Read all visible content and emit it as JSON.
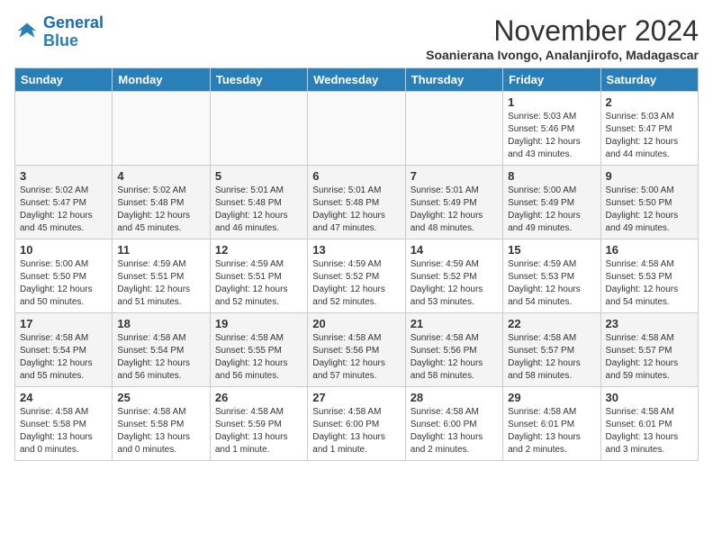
{
  "logo": {
    "line1": "General",
    "line2": "Blue"
  },
  "title": "November 2024",
  "subtitle": "Soanierana Ivongo, Analanjirofo, Madagascar",
  "headers": [
    "Sunday",
    "Monday",
    "Tuesday",
    "Wednesday",
    "Thursday",
    "Friday",
    "Saturday"
  ],
  "weeks": [
    [
      {
        "day": "",
        "info": ""
      },
      {
        "day": "",
        "info": ""
      },
      {
        "day": "",
        "info": ""
      },
      {
        "day": "",
        "info": ""
      },
      {
        "day": "",
        "info": ""
      },
      {
        "day": "1",
        "info": "Sunrise: 5:03 AM\nSunset: 5:46 PM\nDaylight: 12 hours\nand 43 minutes."
      },
      {
        "day": "2",
        "info": "Sunrise: 5:03 AM\nSunset: 5:47 PM\nDaylight: 12 hours\nand 44 minutes."
      }
    ],
    [
      {
        "day": "3",
        "info": "Sunrise: 5:02 AM\nSunset: 5:47 PM\nDaylight: 12 hours\nand 45 minutes."
      },
      {
        "day": "4",
        "info": "Sunrise: 5:02 AM\nSunset: 5:48 PM\nDaylight: 12 hours\nand 45 minutes."
      },
      {
        "day": "5",
        "info": "Sunrise: 5:01 AM\nSunset: 5:48 PM\nDaylight: 12 hours\nand 46 minutes."
      },
      {
        "day": "6",
        "info": "Sunrise: 5:01 AM\nSunset: 5:48 PM\nDaylight: 12 hours\nand 47 minutes."
      },
      {
        "day": "7",
        "info": "Sunrise: 5:01 AM\nSunset: 5:49 PM\nDaylight: 12 hours\nand 48 minutes."
      },
      {
        "day": "8",
        "info": "Sunrise: 5:00 AM\nSunset: 5:49 PM\nDaylight: 12 hours\nand 49 minutes."
      },
      {
        "day": "9",
        "info": "Sunrise: 5:00 AM\nSunset: 5:50 PM\nDaylight: 12 hours\nand 49 minutes."
      }
    ],
    [
      {
        "day": "10",
        "info": "Sunrise: 5:00 AM\nSunset: 5:50 PM\nDaylight: 12 hours\nand 50 minutes."
      },
      {
        "day": "11",
        "info": "Sunrise: 4:59 AM\nSunset: 5:51 PM\nDaylight: 12 hours\nand 51 minutes."
      },
      {
        "day": "12",
        "info": "Sunrise: 4:59 AM\nSunset: 5:51 PM\nDaylight: 12 hours\nand 52 minutes."
      },
      {
        "day": "13",
        "info": "Sunrise: 4:59 AM\nSunset: 5:52 PM\nDaylight: 12 hours\nand 52 minutes."
      },
      {
        "day": "14",
        "info": "Sunrise: 4:59 AM\nSunset: 5:52 PM\nDaylight: 12 hours\nand 53 minutes."
      },
      {
        "day": "15",
        "info": "Sunrise: 4:59 AM\nSunset: 5:53 PM\nDaylight: 12 hours\nand 54 minutes."
      },
      {
        "day": "16",
        "info": "Sunrise: 4:58 AM\nSunset: 5:53 PM\nDaylight: 12 hours\nand 54 minutes."
      }
    ],
    [
      {
        "day": "17",
        "info": "Sunrise: 4:58 AM\nSunset: 5:54 PM\nDaylight: 12 hours\nand 55 minutes."
      },
      {
        "day": "18",
        "info": "Sunrise: 4:58 AM\nSunset: 5:54 PM\nDaylight: 12 hours\nand 56 minutes."
      },
      {
        "day": "19",
        "info": "Sunrise: 4:58 AM\nSunset: 5:55 PM\nDaylight: 12 hours\nand 56 minutes."
      },
      {
        "day": "20",
        "info": "Sunrise: 4:58 AM\nSunset: 5:56 PM\nDaylight: 12 hours\nand 57 minutes."
      },
      {
        "day": "21",
        "info": "Sunrise: 4:58 AM\nSunset: 5:56 PM\nDaylight: 12 hours\nand 58 minutes."
      },
      {
        "day": "22",
        "info": "Sunrise: 4:58 AM\nSunset: 5:57 PM\nDaylight: 12 hours\nand 58 minutes."
      },
      {
        "day": "23",
        "info": "Sunrise: 4:58 AM\nSunset: 5:57 PM\nDaylight: 12 hours\nand 59 minutes."
      }
    ],
    [
      {
        "day": "24",
        "info": "Sunrise: 4:58 AM\nSunset: 5:58 PM\nDaylight: 13 hours\nand 0 minutes."
      },
      {
        "day": "25",
        "info": "Sunrise: 4:58 AM\nSunset: 5:58 PM\nDaylight: 13 hours\nand 0 minutes."
      },
      {
        "day": "26",
        "info": "Sunrise: 4:58 AM\nSunset: 5:59 PM\nDaylight: 13 hours\nand 1 minute."
      },
      {
        "day": "27",
        "info": "Sunrise: 4:58 AM\nSunset: 6:00 PM\nDaylight: 13 hours\nand 1 minute."
      },
      {
        "day": "28",
        "info": "Sunrise: 4:58 AM\nSunset: 6:00 PM\nDaylight: 13 hours\nand 2 minutes."
      },
      {
        "day": "29",
        "info": "Sunrise: 4:58 AM\nSunset: 6:01 PM\nDaylight: 13 hours\nand 2 minutes."
      },
      {
        "day": "30",
        "info": "Sunrise: 4:58 AM\nSunset: 6:01 PM\nDaylight: 13 hours\nand 3 minutes."
      }
    ]
  ]
}
